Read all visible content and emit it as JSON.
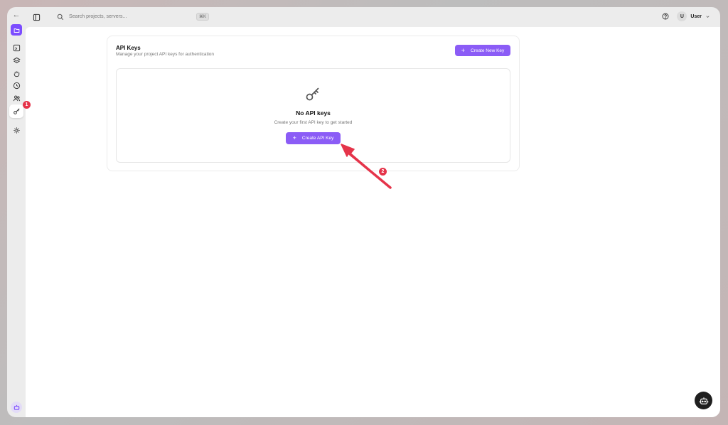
{
  "topbar": {
    "search_placeholder": "Search projects, servers...",
    "search_shortcut": "⌘K",
    "user_initial": "U",
    "user_name": "User"
  },
  "sidebar": {
    "items": [
      "back-icon",
      "project-icon",
      "terminal-icon",
      "layers-icon",
      "hand-icon",
      "clock-icon",
      "users-icon",
      "key-icon",
      "settings-icon"
    ],
    "active": "key-icon"
  },
  "api_keys": {
    "title": "API Keys",
    "subtitle": "Manage your project API keys for authentication",
    "create_new_label": "Create New Key",
    "empty_title": "No API keys",
    "empty_subtitle": "Create your first API key to get started",
    "create_label": "Create API Key"
  },
  "annotations": {
    "step1": "1",
    "step2": "2"
  },
  "colors": {
    "accent": "#8b5cf6",
    "badge": "#e5344a"
  }
}
